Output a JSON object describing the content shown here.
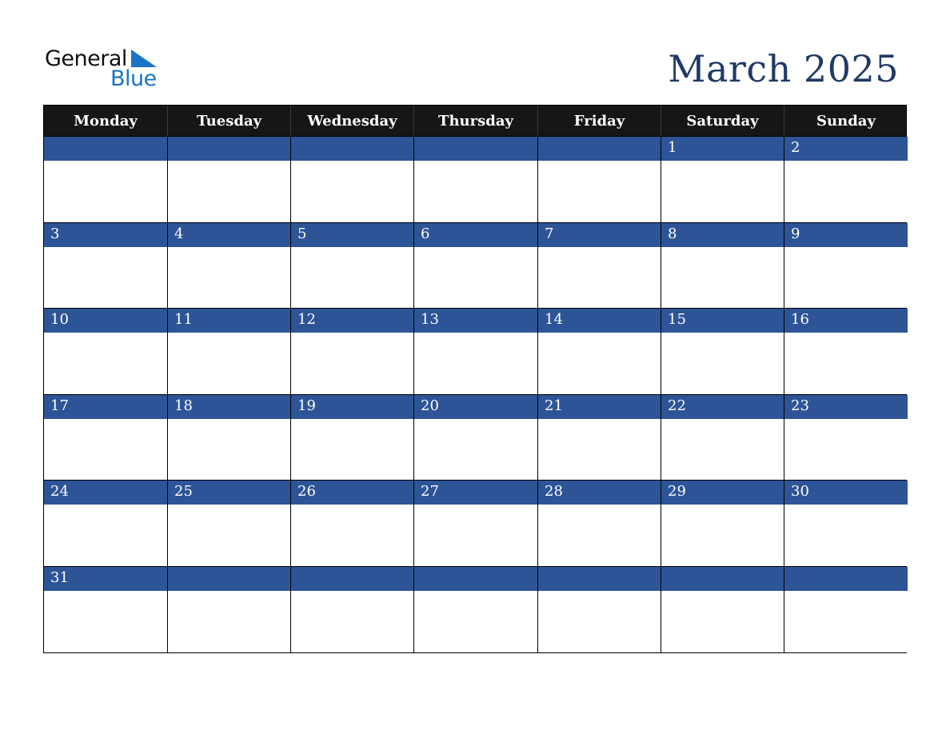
{
  "logo": {
    "word1": "General",
    "word2": "Blue",
    "icon": "flag-triangle-icon",
    "colors": {
      "text": "#111111",
      "accent": "#1a74c4"
    }
  },
  "title": "March 2025",
  "colors": {
    "title": "#1f3a66",
    "header_bg": "#161616",
    "band_bg": "#2d5496"
  },
  "weekdays": [
    "Monday",
    "Tuesday",
    "Wednesday",
    "Thursday",
    "Friday",
    "Saturday",
    "Sunday"
  ],
  "weeks": [
    [
      "",
      "",
      "",
      "",
      "",
      "1",
      "2"
    ],
    [
      "3",
      "4",
      "5",
      "6",
      "7",
      "8",
      "9"
    ],
    [
      "10",
      "11",
      "12",
      "13",
      "14",
      "15",
      "16"
    ],
    [
      "17",
      "18",
      "19",
      "20",
      "21",
      "22",
      "23"
    ],
    [
      "24",
      "25",
      "26",
      "27",
      "28",
      "29",
      "30"
    ],
    [
      "31",
      "",
      "",
      "",
      "",
      "",
      ""
    ]
  ]
}
